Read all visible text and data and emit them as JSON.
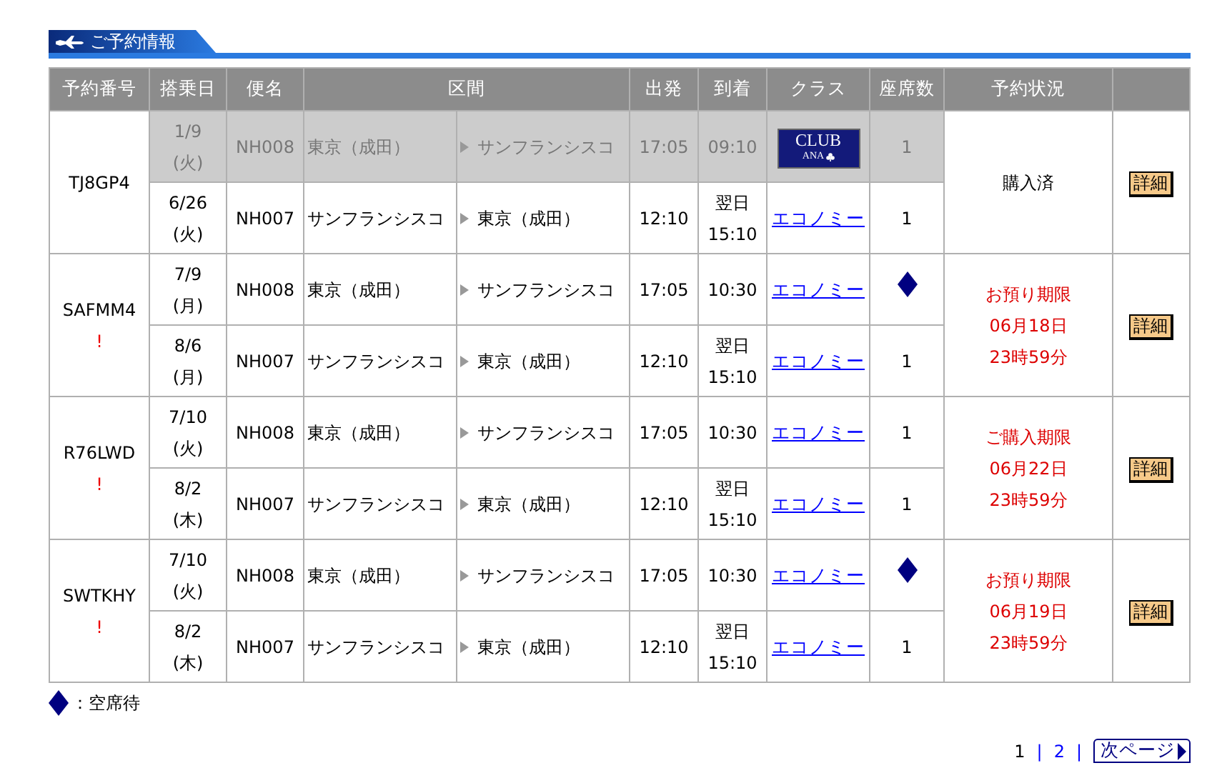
{
  "section_title": "ご予約情報",
  "columns": [
    "予約番号",
    "搭乗日",
    "便名",
    "区間",
    "出発",
    "到着",
    "クラス",
    "座席数",
    "予約状況"
  ],
  "reservations": [
    {
      "code": "TJ8GP4",
      "status": {
        "kind": "purchased",
        "lines": [
          "購入済"
        ]
      },
      "detail_button": "詳細",
      "flights": [
        {
          "date": "1/9",
          "weekday": "(火)",
          "flight": "NH008",
          "from": "東京（成田）",
          "to": "サンフランシスコ",
          "dep": "17:05",
          "arr": "09:10",
          "class": {
            "kind": "logo",
            "top": "CLUB",
            "bottom": "ANA"
          },
          "seats": {
            "kind": "count",
            "text": "1"
          },
          "disabled": true
        },
        {
          "date": "6/26",
          "weekday": "(火)",
          "flight": "NH007",
          "from": "サンフランシスコ",
          "to": "東京（成田）",
          "dep": "12:10",
          "arr_note": "翌日",
          "arr": "15:10",
          "class": {
            "kind": "link",
            "text": "エコノミー"
          },
          "seats": {
            "kind": "count",
            "text": "1"
          },
          "disabled": false
        }
      ]
    },
    {
      "code": "SAFMM4",
      "alert": "!",
      "status": {
        "kind": "deadline",
        "lines": [
          "お預り期限",
          "06月18日",
          "23時59分"
        ]
      },
      "detail_button": "詳細",
      "flights": [
        {
          "date": "7/9",
          "weekday": "(月)",
          "flight": "NH008",
          "from": "東京（成田）",
          "to": "サンフランシスコ",
          "dep": "17:05",
          "arr": "10:30",
          "class": {
            "kind": "link",
            "text": "エコノミー"
          },
          "seats": {
            "kind": "waitlist"
          },
          "disabled": false
        },
        {
          "date": "8/6",
          "weekday": "(月)",
          "flight": "NH007",
          "from": "サンフランシスコ",
          "to": "東京（成田）",
          "dep": "12:10",
          "arr_note": "翌日",
          "arr": "15:10",
          "class": {
            "kind": "link",
            "text": "エコノミー"
          },
          "seats": {
            "kind": "count",
            "text": "1"
          },
          "disabled": false
        }
      ]
    },
    {
      "code": "R76LWD",
      "alert": "!",
      "status": {
        "kind": "deadline",
        "lines": [
          "ご購入期限",
          "06月22日",
          "23時59分"
        ]
      },
      "detail_button": "詳細",
      "flights": [
        {
          "date": "7/10",
          "weekday": "(火)",
          "flight": "NH008",
          "from": "東京（成田）",
          "to": "サンフランシスコ",
          "dep": "17:05",
          "arr": "10:30",
          "class": {
            "kind": "link",
            "text": "エコノミー"
          },
          "seats": {
            "kind": "count",
            "text": "1"
          },
          "disabled": false
        },
        {
          "date": "8/2",
          "weekday": "(木)",
          "flight": "NH007",
          "from": "サンフランシスコ",
          "to": "東京（成田）",
          "dep": "12:10",
          "arr_note": "翌日",
          "arr": "15:10",
          "class": {
            "kind": "link",
            "text": "エコノミー"
          },
          "seats": {
            "kind": "count",
            "text": "1"
          },
          "disabled": false
        }
      ]
    },
    {
      "code": "SWTKHY",
      "alert": "!",
      "status": {
        "kind": "deadline",
        "lines": [
          "お預り期限",
          "06月19日",
          "23時59分"
        ]
      },
      "detail_button": "詳細",
      "flights": [
        {
          "date": "7/10",
          "weekday": "(火)",
          "flight": "NH008",
          "from": "東京（成田）",
          "to": "サンフランシスコ",
          "dep": "17:05",
          "arr": "10:30",
          "class": {
            "kind": "link",
            "text": "エコノミー"
          },
          "seats": {
            "kind": "waitlist"
          },
          "disabled": false
        },
        {
          "date": "8/2",
          "weekday": "(木)",
          "flight": "NH007",
          "from": "サンフランシスコ",
          "to": "東京（成田）",
          "dep": "12:10",
          "arr_note": "翌日",
          "arr": "15:10",
          "class": {
            "kind": "link",
            "text": "エコノミー"
          },
          "seats": {
            "kind": "count",
            "text": "1"
          },
          "disabled": false
        }
      ]
    }
  ],
  "legend": "：空席待",
  "pagination": {
    "pages": [
      {
        "label": "1",
        "selected": true
      },
      {
        "label": "2",
        "selected": false
      }
    ],
    "separator": "|",
    "next": "次ページ"
  }
}
